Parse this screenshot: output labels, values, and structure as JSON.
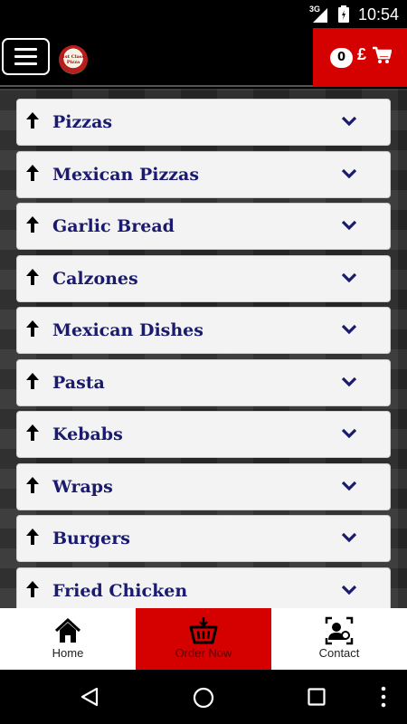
{
  "status_bar": {
    "network": "3G",
    "time": "10:54"
  },
  "header": {
    "logo_text": "1st Class Pizza",
    "cart": {
      "count": "0",
      "currency": "£"
    }
  },
  "categories": [
    {
      "label": "Pizzas"
    },
    {
      "label": "Mexican Pizzas"
    },
    {
      "label": "Garlic Bread"
    },
    {
      "label": "Calzones"
    },
    {
      "label": "Mexican Dishes"
    },
    {
      "label": "Pasta"
    },
    {
      "label": "Kebabs"
    },
    {
      "label": "Wraps"
    },
    {
      "label": "Burgers"
    },
    {
      "label": "Fried Chicken"
    }
  ],
  "bottom_nav": {
    "home": "Home",
    "order_now": "Order Now",
    "contact": "Contact"
  },
  "colors": {
    "accent": "#d50000",
    "category_text": "#1a1a6e",
    "card": "#f3f3f3"
  },
  "icons": [
    "hamburger-menu-icon",
    "cart-icon",
    "arrow-up-icon",
    "chevron-down-icon",
    "home-icon",
    "basket-icon",
    "contact-card-icon",
    "back-icon",
    "home-circle-icon",
    "recents-icon",
    "overflow-icon"
  ]
}
